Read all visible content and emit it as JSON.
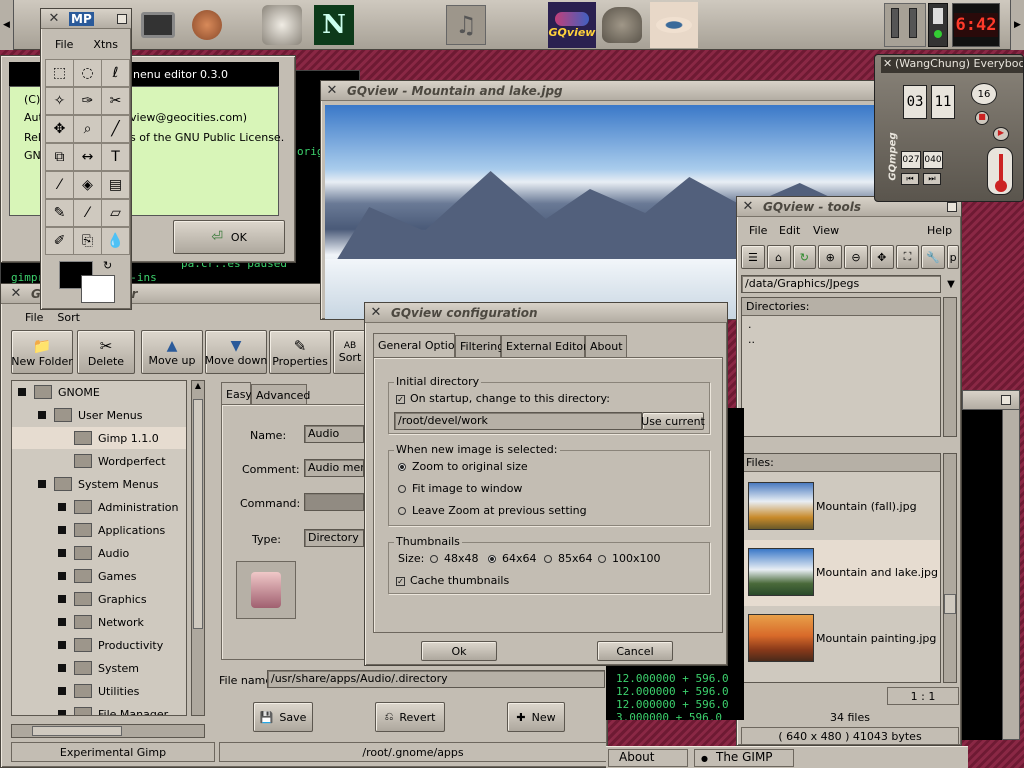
{
  "panel": {
    "gqview_launcher": "GQview",
    "clock": "6:42",
    "gimp_tag": "MP",
    "launcher_icons": [
      "monitor-icon",
      "feather-icon",
      "gnu-icon",
      "netscape-icon",
      "music-note-icon",
      "gqview-glasses-icon",
      "gimp-icon",
      "eye-icon"
    ]
  },
  "toolbox": {
    "menu": [
      "File",
      "Xtns"
    ]
  },
  "menu_editor_about": {
    "title": "nenu editor 0.3.0",
    "line_c": "(C)",
    "line_auth": "Auth",
    "line_email": "view@geocities.com)",
    "line_rele": "Rele",
    "line_license": "s of the GNU Public License.",
    "line_gn": "GN",
    "ok": "OK"
  },
  "term_left": {
    "lines": [
      "origi",
      "pa.cr..es   paused",
      "gimprc   gimprc   plug-ins"
    ]
  },
  "menu_editor": {
    "title": "G",
    "title_tail": "ditor",
    "menu": [
      "File",
      "Sort"
    ],
    "toolbar": [
      "New Folder",
      "Delete",
      "Move up",
      "Move down",
      "Properties",
      "Sort"
    ],
    "tree": [
      {
        "label": "GNOME",
        "level": 0
      },
      {
        "label": "User Menus",
        "level": 1
      },
      {
        "label": "Gimp 1.1.0",
        "level": 2,
        "selected": true
      },
      {
        "label": "Wordperfect",
        "level": 2
      },
      {
        "label": "System Menus",
        "level": 1
      },
      {
        "label": "Administration",
        "level": 2
      },
      {
        "label": "Applications",
        "level": 2
      },
      {
        "label": "Audio",
        "level": 2
      },
      {
        "label": "Games",
        "level": 2
      },
      {
        "label": "Graphics",
        "level": 2
      },
      {
        "label": "Network",
        "level": 2
      },
      {
        "label": "Productivity",
        "level": 2
      },
      {
        "label": "System",
        "level": 2
      },
      {
        "label": "Utilities",
        "level": 2
      },
      {
        "label": "File Manager",
        "level": 2
      }
    ],
    "tabs": [
      "Easy",
      "Advanced"
    ],
    "name_label": "Name:",
    "name_value": "Audio",
    "comment_label": "Comment:",
    "comment_value": "Audio menu",
    "command_label": "Command:",
    "command_value": "",
    "type_label": "Type:",
    "type_value": "Directory",
    "filename_label": "File name:",
    "filename_value": "/usr/share/apps/Audio/.directory",
    "save": "Save",
    "revert": "Revert",
    "new": "New",
    "status_left": "Experimental Gimp",
    "status_right": "/root/.gnome/apps"
  },
  "gqview_main": {
    "title": "GQview - Mountain and lake.jpg"
  },
  "gqview_config": {
    "title": "GQview configuration",
    "tabs": [
      "General Options",
      "Filtering",
      "External Editors",
      "About"
    ],
    "initial_dir_group": "Initial directory",
    "startup_check": "On startup, change to this directory:",
    "dir_value": "/root/devel/work",
    "use_current": "Use current",
    "new_image_group": "When new image is selected:",
    "radio_zoom_original": "Zoom to original size",
    "radio_fit": "Fit image to window",
    "radio_leave": "Leave Zoom at previous setting",
    "thumbs_group": "Thumbnails",
    "size_label": "Size:",
    "sizes": [
      "48x48",
      "64x64",
      "85x64",
      "100x100"
    ],
    "cache_thumbs": "Cache thumbnails",
    "ok": "Ok",
    "cancel": "Cancel"
  },
  "gqview_tools": {
    "title": "GQview - tools",
    "menu": [
      "File",
      "Edit",
      "View",
      "Help"
    ],
    "path": "/data/Graphics/Jpegs",
    "directories_label": "Directories:",
    "dirs": [
      ".",
      ".."
    ],
    "files_label": "Files:",
    "files": [
      "Mountain (fall).jpg",
      "Mountain and lake.jpg",
      "Mountain painting.jpg"
    ],
    "zoom": "1 : 1",
    "file_count": "34 files",
    "info": "( 640 x 480 ) 41043 bytes"
  },
  "gqmpeg": {
    "title": "(WangChung) Everybod",
    "minutes": "03",
    "seconds": "11",
    "track": "16",
    "time_a": "027",
    "time_b": "040",
    "logo": "GQmpeg"
  },
  "term_right": {
    "lines": [
      "12.000000 + 596.0",
      "12.000000 + 596.0",
      "12.000000 + 596.0",
      "3.000000 + 596.0"
    ]
  },
  "taskbar": {
    "about": "About",
    "gimp": "The GIMP"
  }
}
